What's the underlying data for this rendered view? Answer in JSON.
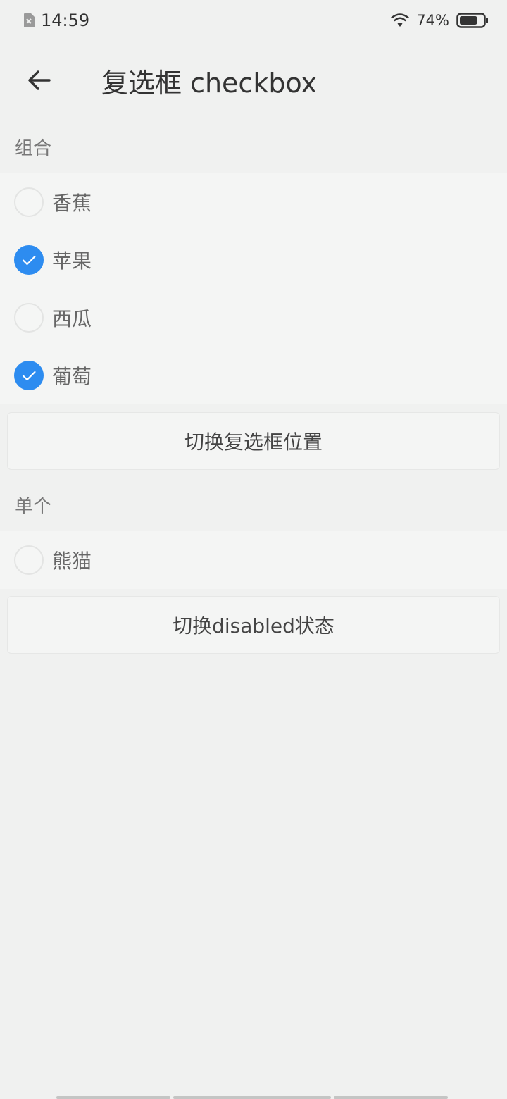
{
  "status_bar": {
    "time": "14:59",
    "battery_percent": "74%",
    "battery_level": 0.74,
    "icons": [
      "sim-icon",
      "wifi-icon",
      "battery-icon"
    ]
  },
  "header": {
    "back_icon": "arrow-left-icon",
    "title": "复选框 checkbox"
  },
  "group_section": {
    "label": "组合",
    "items": [
      {
        "label": "香蕉",
        "checked": false
      },
      {
        "label": "苹果",
        "checked": true
      },
      {
        "label": "西瓜",
        "checked": false
      },
      {
        "label": "葡萄",
        "checked": true
      }
    ],
    "toggle_position_label": "切换复选框位置"
  },
  "single_section": {
    "label": "单个",
    "item": {
      "label": "熊猫",
      "checked": false
    },
    "toggle_disabled_label": "切换disabled状态"
  },
  "colors": {
    "accent": "#2d8cf0",
    "background": "#f0f1f0",
    "panel": "#f4f5f4",
    "text": "#333333",
    "muted_text": "#777777"
  }
}
